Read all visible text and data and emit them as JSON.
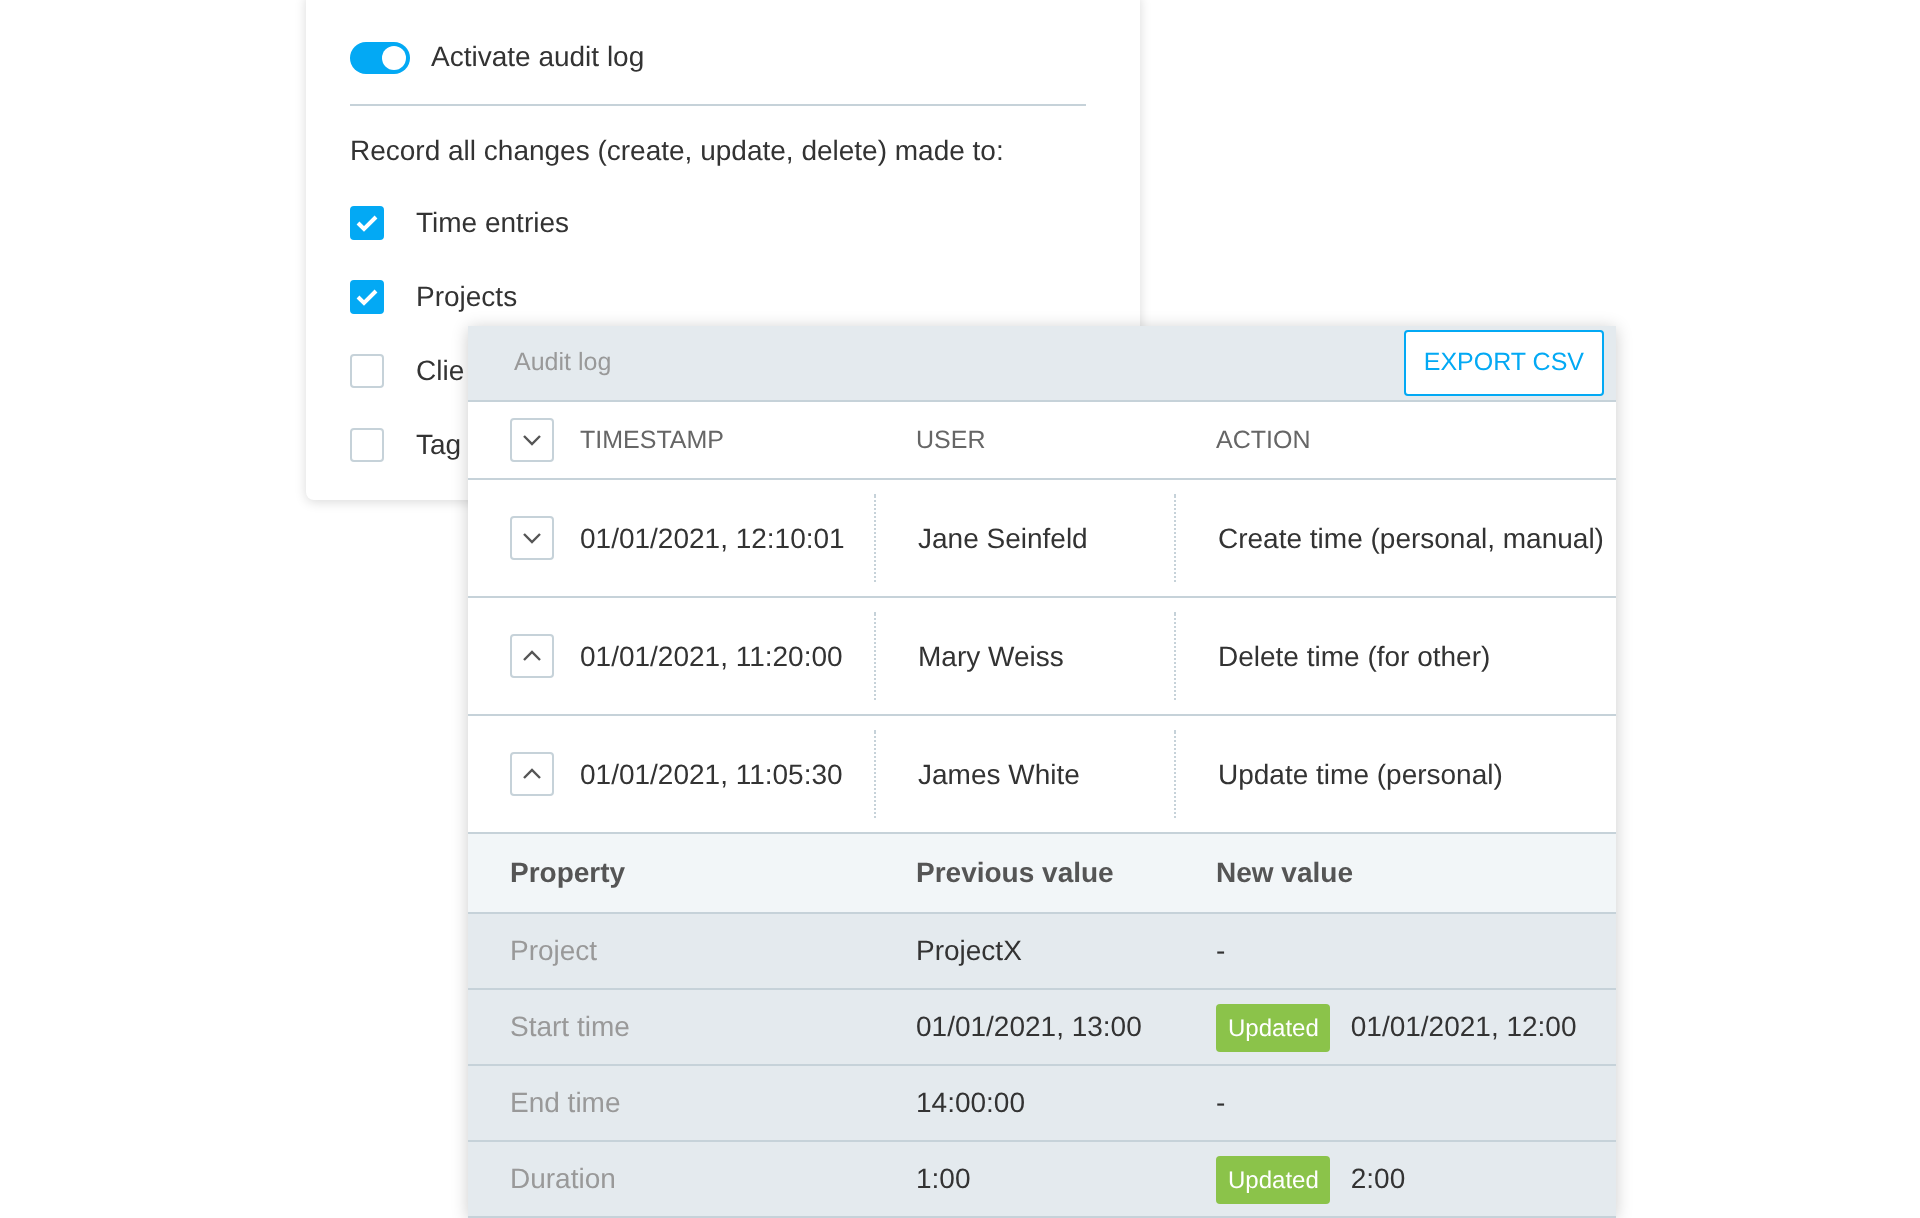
{
  "settings": {
    "toggle": {
      "label": "Activate audit log",
      "on": true
    },
    "description": "Record all changes (create, update, delete) made to:",
    "options": [
      {
        "label": "Time entries",
        "checked": true
      },
      {
        "label": "Projects",
        "checked": true
      },
      {
        "label": "Clie",
        "checked": false
      },
      {
        "label": "Tag",
        "checked": false
      }
    ]
  },
  "audit_log": {
    "title": "Audit log",
    "export_button": "EXPORT CSV",
    "header": {
      "expanded": false,
      "columns": [
        "TIMESTAMP",
        "USER",
        "ACTION"
      ]
    },
    "rows": [
      {
        "timestamp": "01/01/2021, 12:10:01",
        "user": "Jane Seinfeld",
        "action": "Create time (personal, manual)",
        "expanded": false
      },
      {
        "timestamp": "01/01/2021, 11:20:00",
        "user": "Mary Weiss",
        "action": "Delete time (for other)",
        "expanded": true
      },
      {
        "timestamp": "01/01/2021, 11:05:30",
        "user": "James White",
        "action": "Update time (personal)",
        "expanded": true,
        "details": {
          "columns": [
            "Property",
            "Previous value",
            "New value"
          ],
          "rows": [
            {
              "property": "Project",
              "previous": "ProjectX",
              "new": "-"
            },
            {
              "property": "Start time",
              "previous": "01/01/2021, 13:00",
              "badge": "Updated",
              "new": "01/01/2021, 12:00"
            },
            {
              "property": "End time",
              "previous": "14:00:00",
              "new": "-"
            },
            {
              "property": "Duration",
              "previous": "1:00",
              "badge": "Updated",
              "new": "2:00"
            }
          ]
        }
      }
    ]
  }
}
